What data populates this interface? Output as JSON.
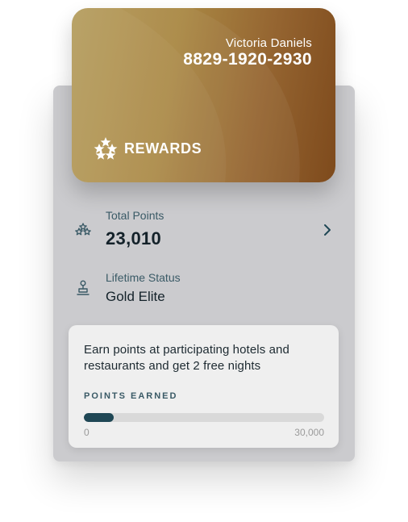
{
  "card": {
    "holder_name": "Victoria Daniels",
    "card_number": "8829-1920-2930",
    "brand_label": "REWARDS",
    "brand_icon": "stars-icon",
    "gradient_colors": [
      "#b49b5a",
      "#a98743",
      "#956531",
      "#7e4a1c"
    ]
  },
  "points": {
    "label": "Total Points",
    "value": "23,010",
    "icon": "stars-outline-icon",
    "action_icon": "chevron-right-icon"
  },
  "status": {
    "label": "Lifetime Status",
    "value": "Gold Elite",
    "icon": "bellhop-icon"
  },
  "promo": {
    "text": "Earn points at participating hotels and restaurants and get 2 free nights",
    "progress_caption": "POINTS EARNED",
    "progress_min_label": "0",
    "progress_max_label": "30,000",
    "progress_fraction": 0.125,
    "progress_color": "#1f4755"
  },
  "colors": {
    "accent_text": "#3a5a66",
    "panel_background": "#cbcbce"
  }
}
